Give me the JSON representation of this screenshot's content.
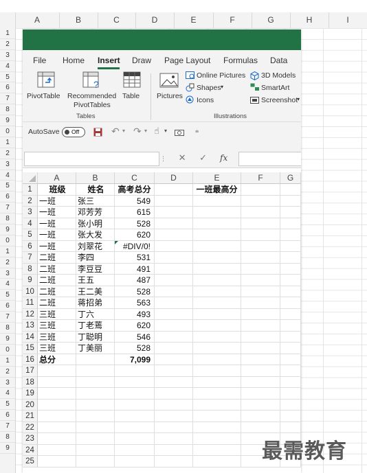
{
  "background": {
    "columns": [
      "A",
      "B",
      "C",
      "D",
      "E",
      "F",
      "G",
      "H",
      "I"
    ],
    "rows": [
      "1",
      "2",
      "3",
      "4",
      "5",
      "6",
      "7",
      "8",
      "9",
      "0",
      "1",
      "2",
      "3",
      "4",
      "5",
      "6",
      "7",
      "8",
      "9",
      "0",
      "1",
      "2",
      "3",
      "4",
      "5",
      "6",
      "7",
      "8",
      "9",
      "0",
      "1",
      "2",
      "3",
      "4",
      "5",
      "6",
      "7",
      "8",
      "9"
    ]
  },
  "window": {
    "tabs": [
      "File",
      "Home",
      "Insert",
      "Draw",
      "Page Layout",
      "Formulas",
      "Data"
    ],
    "active_tab": "Insert",
    "ribbon": {
      "pivot": "PivotTable",
      "rec_line1": "Recommended",
      "rec_line2": "PivotTables",
      "table": "Table",
      "tables_group": "Tables",
      "pictures": "Pictures",
      "online_pictures": "Online Pictures",
      "shapes": "Shapes",
      "icons": "Icons",
      "models": "3D Models",
      "smartart": "SmartArt",
      "screenshot": "Screenshot",
      "illustrations_group": "Illustrations"
    },
    "qat": {
      "autosave": "AutoSave",
      "toggle": "Off"
    },
    "formula_bar": {
      "fx": "fx"
    }
  },
  "sheet": {
    "columns": [
      "A",
      "B",
      "C",
      "D",
      "E",
      "F",
      "G"
    ],
    "rows": [
      {
        "n": "1",
        "a": "班级",
        "b": "姓名",
        "c": "高考总分",
        "e": "一班最高分"
      },
      {
        "n": "2",
        "a": "一班",
        "b": "张三",
        "c": "549"
      },
      {
        "n": "3",
        "a": "一班",
        "b": "邓芳芳",
        "c": "615"
      },
      {
        "n": "4",
        "a": "一班",
        "b": "张小明",
        "c": "528"
      },
      {
        "n": "5",
        "a": "一班",
        "b": "张大发",
        "c": "620"
      },
      {
        "n": "6",
        "a": "一班",
        "b": "刘翠花",
        "c": "#DIV/0!"
      },
      {
        "n": "7",
        "a": "二班",
        "b": "李四",
        "c": "531"
      },
      {
        "n": "8",
        "a": "二班",
        "b": "李豆豆",
        "c": "491"
      },
      {
        "n": "9",
        "a": "二班",
        "b": "王五",
        "c": "487"
      },
      {
        "n": "10",
        "a": "二班",
        "b": "王二美",
        "c": "528"
      },
      {
        "n": "11",
        "a": "二班",
        "b": "蒋招弟",
        "c": "563"
      },
      {
        "n": "12",
        "a": "三班",
        "b": "丁六",
        "c": "493"
      },
      {
        "n": "13",
        "a": "三班",
        "b": "丁老蔫",
        "c": "620"
      },
      {
        "n": "14",
        "a": "三班",
        "b": "丁聪明",
        "c": "546"
      },
      {
        "n": "15",
        "a": "三班",
        "b": "丁美丽",
        "c": "528"
      },
      {
        "n": "16",
        "a": "总分",
        "b": "",
        "c": "7,099"
      },
      {
        "n": "17"
      },
      {
        "n": "18"
      },
      {
        "n": "19"
      },
      {
        "n": "20"
      },
      {
        "n": "21"
      },
      {
        "n": "22"
      },
      {
        "n": "23"
      },
      {
        "n": "24"
      },
      {
        "n": "25"
      }
    ]
  },
  "watermark": "最需教育",
  "colors": {
    "accent": "#217346",
    "save": "#a4373a"
  }
}
